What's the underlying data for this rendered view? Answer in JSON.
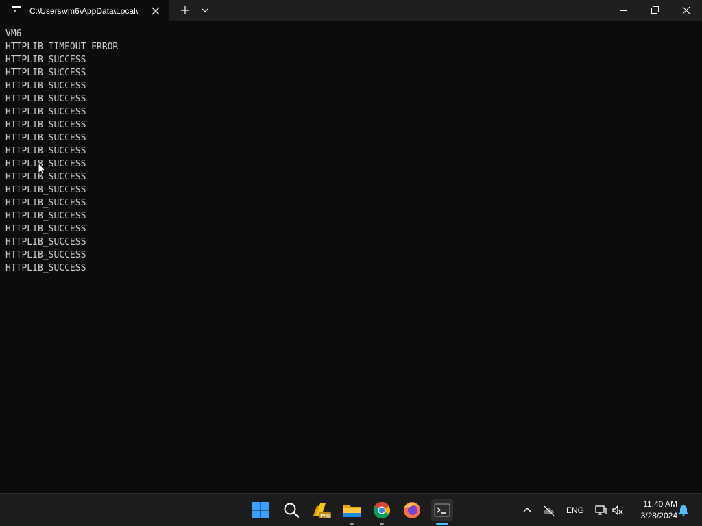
{
  "window": {
    "tab_title": "C:\\Users\\vm6\\AppData\\Local\\"
  },
  "terminal": {
    "lines": [
      "VM6",
      "HTTPLIB_TIMEOUT_ERROR",
      "HTTPLIB_SUCCESS",
      "HTTPLIB_SUCCESS",
      "HTTPLIB_SUCCESS",
      "HTTPLIB_SUCCESS",
      "HTTPLIB_SUCCESS",
      "HTTPLIB_SUCCESS",
      "HTTPLIB_SUCCESS",
      "HTTPLIB_SUCCESS",
      "HTTPLIB_SUCCESS",
      "HTTPLIB_SUCCESS",
      "HTTPLIB_SUCCESS",
      "HTTPLIB_SUCCESS",
      "HTTPLIB_SUCCESS",
      "HTTPLIB_SUCCESS",
      "HTTPLIB_SUCCESS",
      "HTTPLIB_SUCCESS",
      "HTTPLIB_SUCCESS"
    ]
  },
  "taskbar": {
    "apps": [
      "start-icon",
      "search-icon",
      "powerbi-preview-icon",
      "file-explorer-icon",
      "chrome-icon",
      "firefox-icon",
      "terminal-icon"
    ],
    "active_app": "terminal-icon",
    "accent_color": "#4cc2ff"
  },
  "tray": {
    "language": "ENG",
    "time": "11:40 AM",
    "date": "3/28/2024",
    "icons": [
      "chevron-up-icon",
      "onedrive-offline-icon",
      "network-icon",
      "speaker-muted-icon",
      "bell-icon"
    ]
  }
}
